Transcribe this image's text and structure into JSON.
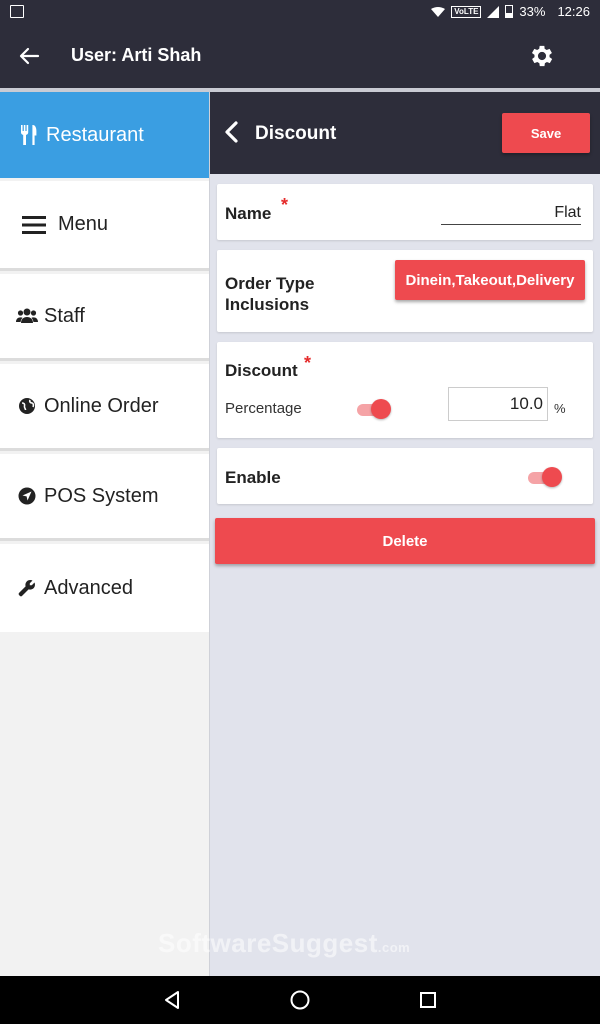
{
  "status_bar": {
    "volte": "VoLTE",
    "battery": "33%",
    "time": "12:26"
  },
  "app_bar": {
    "title": "User: Arti Shah"
  },
  "sidebar": {
    "items": [
      {
        "label": "Restaurant",
        "icon": "utensils-icon",
        "active": true
      },
      {
        "label": "Menu",
        "icon": "menu-icon",
        "active": false
      },
      {
        "label": "Staff",
        "icon": "users-icon",
        "active": false
      },
      {
        "label": "Online Order",
        "icon": "globe-icon",
        "active": false
      },
      {
        "label": "POS System",
        "icon": "location-arrow-icon",
        "active": false
      },
      {
        "label": "Advanced",
        "icon": "wrench-icon",
        "active": false
      }
    ]
  },
  "content": {
    "header_title": "Discount",
    "save_label": "Save",
    "name_label": "Name",
    "required_mark": "*",
    "name_value": "Flat",
    "order_type_label_line1": "Order Type",
    "order_type_label_line2": "Inclusions",
    "order_type_value": "Dinein,Takeout,Delivery",
    "discount_label": "Discount",
    "percentage_label": "Percentage",
    "percentage_toggle_on": true,
    "discount_value": "10.0",
    "percent_sign": "%",
    "enable_label": "Enable",
    "enable_toggle_on": true,
    "delete_label": "Delete"
  },
  "watermark": {
    "main": "SoftwareSuggest",
    "suffix": ".com"
  },
  "colors": {
    "dark_bar": "#2d2d3a",
    "accent_red": "#ee4a4f",
    "active_blue": "#3a9ee2",
    "content_bg": "#e1e3ec"
  }
}
